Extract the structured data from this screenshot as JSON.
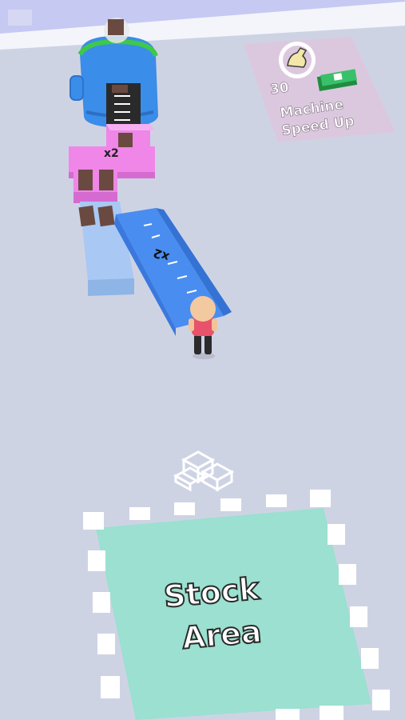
{
  "upgrade_pad": {
    "cost": "30",
    "title_line1": "Machine",
    "title_line2": "Speed Up",
    "icon": "flexed-arm-icon",
    "currency_icon": "cash-stack-icon"
  },
  "machine": {
    "icon": "box-processing-machine"
  },
  "conveyor_labels": {
    "pink_multiplier": "x2",
    "blue_multiplier": "x2"
  },
  "stock_area": {
    "line1": "Stock",
    "line2": "Area",
    "icon": "stacked-boxes-icon"
  },
  "colors": {
    "floor": "#ced3e4",
    "wall": "#f1f2f8",
    "machine_blue": "#3a8de8",
    "machine_green": "#3ec94a",
    "conveyor_pink": "#ef86e8",
    "conveyor_blue": "#4a8df0",
    "conveyor_light_blue": "#a9c8f4",
    "upgrade_pad": "#dcc8de",
    "stock_pad": "#9be0d0",
    "player_shirt": "#e8536b"
  }
}
